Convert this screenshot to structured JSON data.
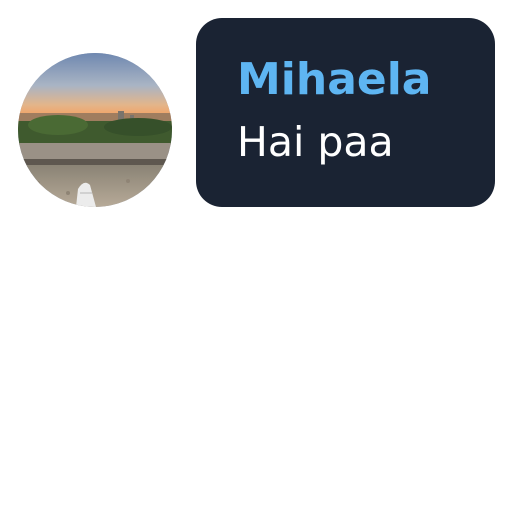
{
  "message": {
    "sender_name": "Mihaela",
    "text": "Hai paa"
  },
  "avatar": {
    "icon": "avatar-photo-sunset-landscape"
  },
  "colors": {
    "bubble_background": "#1a2333",
    "sender_name": "#5eb5f2",
    "message_text": "#ffffff",
    "page_background": "#ffffff"
  }
}
